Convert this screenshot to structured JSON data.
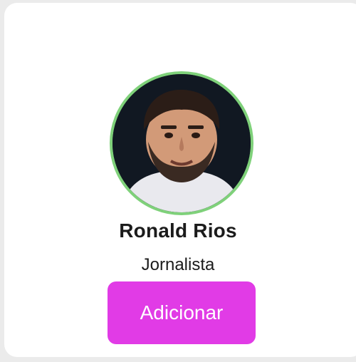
{
  "profile": {
    "name": "Ronald Rios",
    "role": "Jornalista",
    "avatar_icon": "user-photo",
    "ring_color": "#7fd17a"
  },
  "actions": {
    "add_label": "Adicionar",
    "button_color": "#e13be6"
  }
}
